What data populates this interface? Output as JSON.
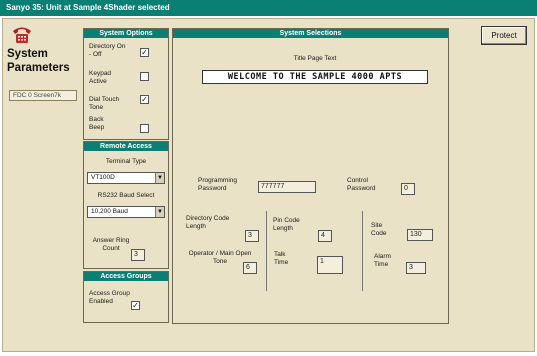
{
  "window": {
    "title": "Sanyo 35: Unit at Sample 4Shader selected"
  },
  "sidebar": {
    "title": "System Parameters",
    "field_value": "FDC 0 Screen7k"
  },
  "toolbar": {
    "protect_label": "Protect"
  },
  "system_options": {
    "header": "System Options",
    "directory_label": "Directory On - Off",
    "directory_checked": "✓",
    "keypad_label": "Keypad Active",
    "keypad_checked": "",
    "dial_touch_label": "Dial Touch Tone",
    "dial_touch_checked": "✓",
    "back_beep_label": "Back Beep",
    "back_beep_checked": ""
  },
  "remote_access": {
    "header": "Remote Access",
    "terminal_type_label": "Terminal Type",
    "terminal_type_value": "VT100D",
    "baud_label": "RS232 Baud Select",
    "baud_value": "10,200 Baud",
    "answer_ring_label": "Answer Ring Count",
    "answer_ring_value": "3"
  },
  "access_groups": {
    "header": "Access Groups",
    "enabled_label": "Access Group Enabled",
    "enabled_checked": "✓"
  },
  "system_selections": {
    "header": "System Selections",
    "title_page_label": "Title Page Text",
    "title_page_value": "WELCOME TO THE SAMPLE 4000 APTS",
    "programming_password_label": "Programming Password",
    "programming_password_value": "777777",
    "control_password_label": "Control Password",
    "control_password_value": "0",
    "directory_code_length_label": "Directory Code Length",
    "directory_code_length_value": "3",
    "pin_code_length_label": "Pin Code Length",
    "pin_code_length_value": "4",
    "site_code_label": "Site Code",
    "site_code_value": "130",
    "talk_time_label": "Talk Time",
    "talk_time_value": "1",
    "operator_open_tone_label": "Operator / Main Open Tone",
    "operator_open_tone_value": "6",
    "alarm_time_label": "Alarm Time",
    "alarm_time_value": "3"
  },
  "icons": {
    "phone": "phone-icon",
    "dropdown_arrow": "chevron-down-icon"
  },
  "colors": {
    "accent": "#0b7f73",
    "panel_background": "#e9e2c6"
  }
}
